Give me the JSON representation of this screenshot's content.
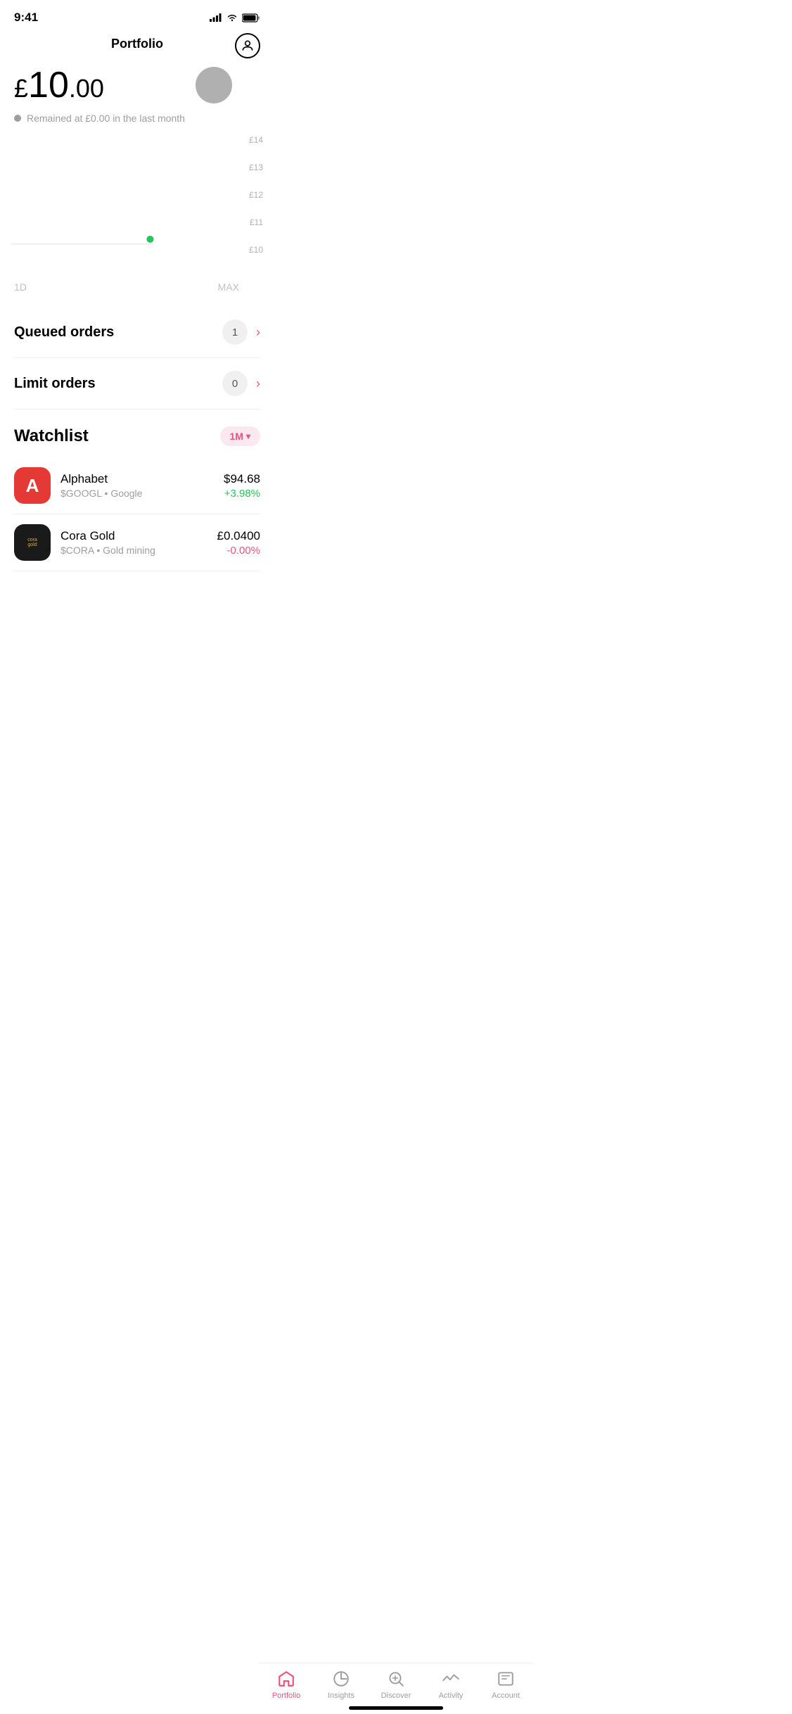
{
  "status_bar": {
    "time": "9:41"
  },
  "header": {
    "title": "Portfolio"
  },
  "portfolio": {
    "currency_symbol": "£",
    "whole": "10",
    "decimal": ".00",
    "change_text": "Remained at £0.00 in the last month"
  },
  "chart": {
    "y_labels": [
      "£14",
      "£13",
      "£12",
      "£11",
      "£10"
    ],
    "time_labels": [
      "1D",
      "MAX"
    ]
  },
  "orders": [
    {
      "label": "Queued orders",
      "count": "1"
    },
    {
      "label": "Limit orders",
      "count": "0"
    }
  ],
  "watchlist": {
    "title": "Watchlist",
    "filter": "1M",
    "stocks": [
      {
        "name": "Alphabet",
        "ticker": "$GOOGL",
        "exchange": "Google",
        "price": "$94.68",
        "change": "+3.98%",
        "change_type": "positive",
        "logo_letter": "A",
        "logo_type": "alphabet"
      },
      {
        "name": "Cora Gold",
        "ticker": "$CORA",
        "exchange": "Gold mining",
        "price": "£0.0400",
        "change": "-0.00%",
        "change_type": "negative",
        "logo_letter": "cora gold",
        "logo_type": "cora"
      }
    ]
  },
  "nav": {
    "items": [
      {
        "id": "portfolio",
        "label": "Portfolio",
        "active": true
      },
      {
        "id": "insights",
        "label": "Insights",
        "active": false
      },
      {
        "id": "discover",
        "label": "Discover",
        "active": false
      },
      {
        "id": "activity",
        "label": "Activity",
        "active": false
      },
      {
        "id": "account",
        "label": "Account",
        "active": false
      }
    ]
  }
}
